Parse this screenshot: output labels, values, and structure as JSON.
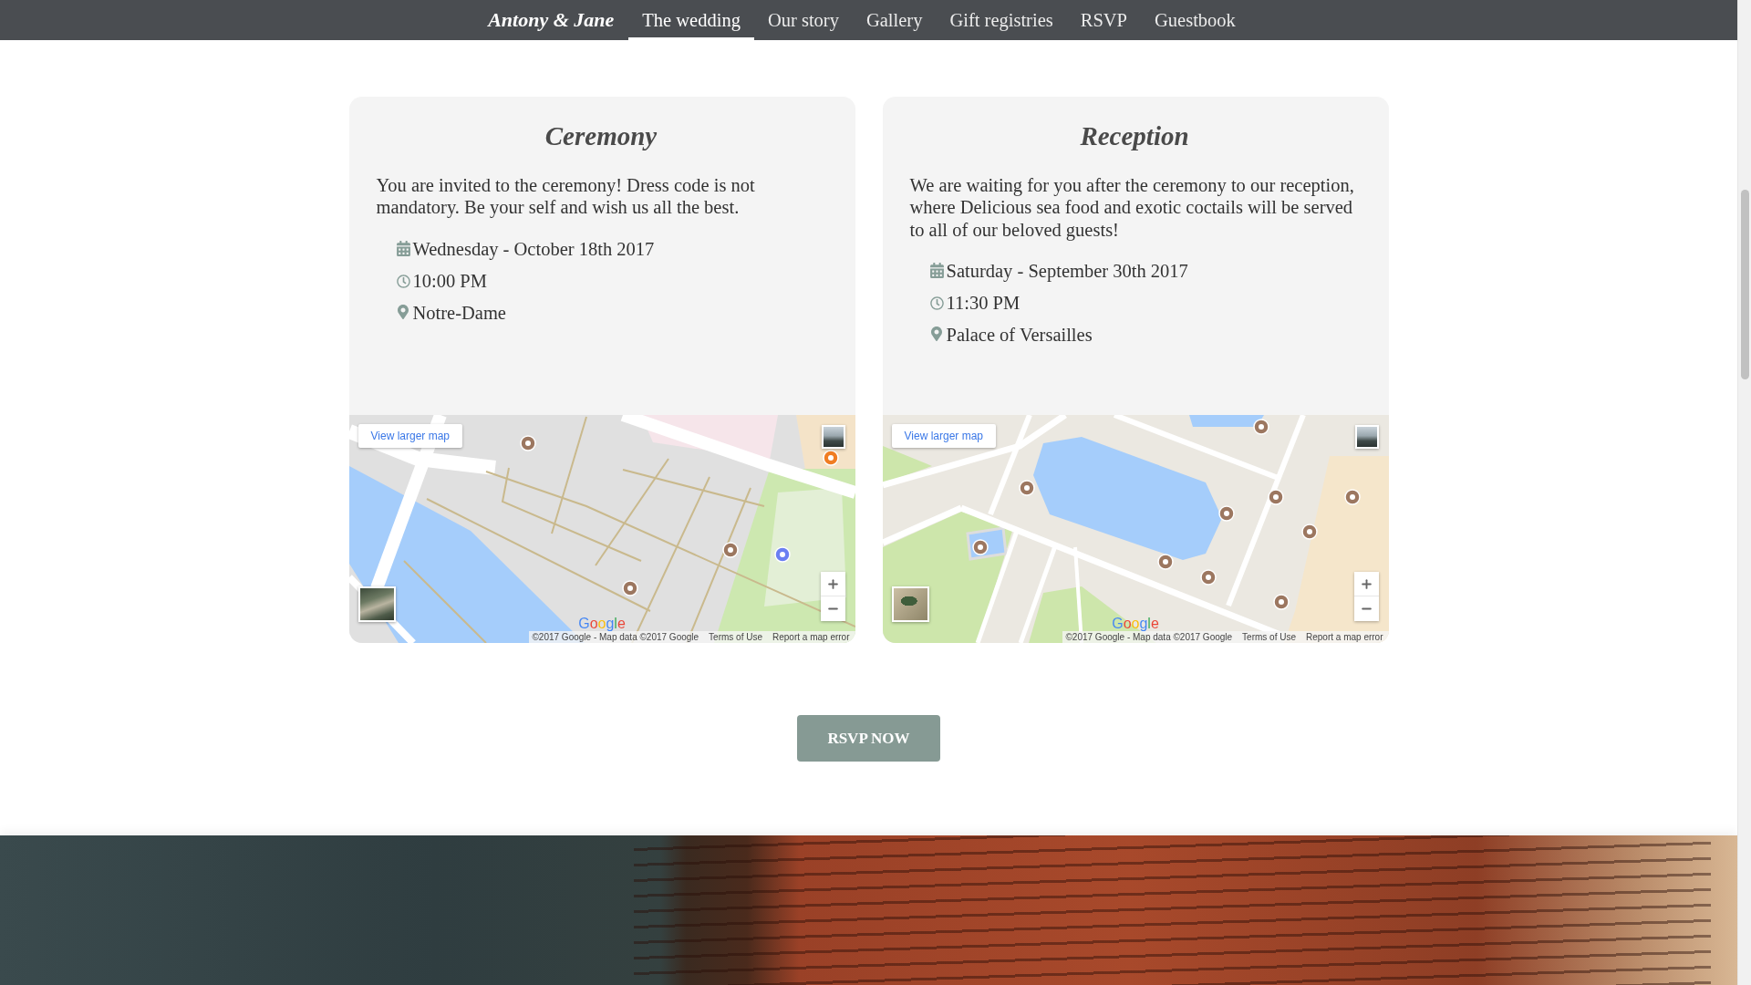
{
  "nav": {
    "brand": "Antony & Jane",
    "items": [
      {
        "label": "The wedding",
        "selected": true
      },
      {
        "label": "Our story",
        "selected": false
      },
      {
        "label": "Gallery",
        "selected": false
      },
      {
        "label": "Gift registries",
        "selected": false
      },
      {
        "label": "RSVP",
        "selected": false
      },
      {
        "label": "Guestbook",
        "selected": false
      }
    ]
  },
  "events": [
    {
      "title": "Ceremony",
      "description": "You are invited to the ceremony! Dress code is not mandatory. Be your self and wish us all the best.",
      "details": [
        {
          "kind": "date",
          "text": "Wednesday - October 18th 2017"
        },
        {
          "kind": "time",
          "text": "10:00 PM"
        },
        {
          "kind": "location",
          "text": "Notre-Dame"
        }
      ],
      "map": {
        "kind": "river",
        "link": "View larger map",
        "logo": "Google",
        "attribution": "©2017 Google - Map data ©2017 Google",
        "terms": "Terms of Use",
        "report": "Report a map error"
      }
    },
    {
      "title": "Reception",
      "description": "We are waiting for you after the ceremony to our reception, where Delicious sea food and exotic coctails will be served to all of our beloved guests!",
      "details": [
        {
          "kind": "date",
          "text": "Saturday - September 30th 2017"
        },
        {
          "kind": "time",
          "text": "11:30 PM"
        },
        {
          "kind": "location",
          "text": "Palace of Versailles"
        }
      ],
      "map": {
        "kind": "lake",
        "link": "View larger map",
        "logo": "Google",
        "attribution": "©2017 Google - Map data ©2017 Google",
        "terms": "Terms of Use",
        "report": "Report a map error"
      }
    }
  ],
  "rsvp_button": "RSVP NOW"
}
